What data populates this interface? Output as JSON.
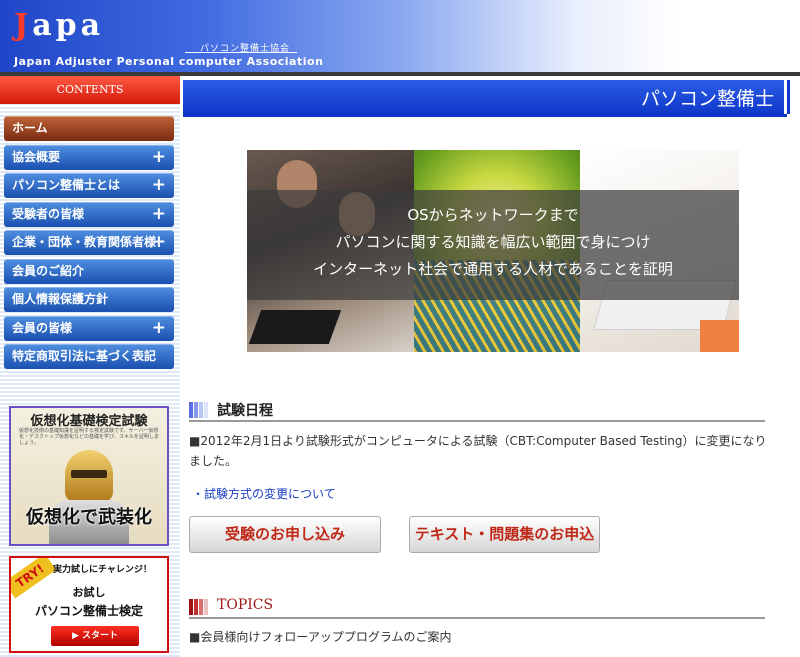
{
  "header": {
    "logo_first": "J",
    "logo_rest": "apa",
    "logo_jp": "パソコン整備士協会",
    "logo_en": "Japan Adjuster Personal computer  Association"
  },
  "sidebar": {
    "contents_label": "CONTENTS",
    "items": [
      {
        "label": "ホーム",
        "has_plus": false
      },
      {
        "label": "協会概要",
        "has_plus": true
      },
      {
        "label": "パソコン整備士とは",
        "has_plus": true
      },
      {
        "label": "受験者の皆様",
        "has_plus": true
      },
      {
        "label": "企業・団体・教育関係者様",
        "has_plus": true
      },
      {
        "label": "会員のご紹介",
        "has_plus": false
      },
      {
        "label": "個人情報保護方針",
        "has_plus": false
      },
      {
        "label": "会員の皆様",
        "has_plus": true
      },
      {
        "label": "特定商取引法に基づく表記",
        "has_plus": false
      }
    ],
    "plus_symbol": "+",
    "banner1": {
      "title": "仮想化基礎検定試験",
      "small_text": "仮想化技術の基礎知識を証明する検定試験です。サーバー仮想化・デスクトップ仮想化などの基礎を学び、スキルを証明しましょう。",
      "big_text": "仮想化で武装化"
    },
    "banner2": {
      "try_label": "TRY!",
      "line1": "実力試しにチャレンジ！",
      "line2": "お試し",
      "line3": "パソコン整備士検定",
      "button_label": "▶ スタート"
    }
  },
  "main": {
    "title": "パソコン整備士",
    "hero_lines": [
      "OSからネットワークまで",
      "パソコンに関する知識を幅広い範囲で身につけ",
      "インターネット社会で通用する人材であることを証明"
    ],
    "exam_section": {
      "title": "試験日程",
      "paragraph": "■2012年2月1日より試験形式がコンピュータによる試験（CBT:Computer Based Testing）に変更になりました。",
      "link": "・試験方式の変更について",
      "button1": "受験のお申し込み",
      "button2": "テキスト・問題集のお申込"
    },
    "topics_section": {
      "title": "TOPICS",
      "item1": "■会員様向けフォローアッププログラムのご案内"
    }
  },
  "colors": {
    "brand_blue": "#1038c8",
    "accent_red": "#d41a08",
    "exam_bar": "#8898e8",
    "topics_bar": "#b02020"
  }
}
